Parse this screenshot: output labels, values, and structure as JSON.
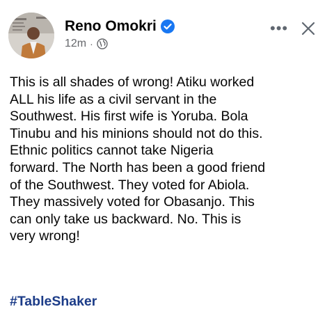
{
  "post": {
    "author": "Reno Omokri",
    "verified_icon": "verified-badge-icon",
    "timestamp": "12m",
    "separator": "·",
    "audience_icon": "globe-icon",
    "more_options": "•••",
    "close_icon": "close-icon",
    "body": "This is all shades of wrong! Atiku worked\nALL his life as a civil servant in the\nSouthwest. His first wife is Yoruba. Bola\nTinubu and his minions should not do this.\nEthnic politics cannot take Nigeria\nforward. The North has been a good friend\nof the Southwest. They voted for Abiola.\nThey massively voted for Obasanjo. This\ncan only take us backward. No. This is\nvery wrong!",
    "hashtag": "#TableShaker"
  },
  "colors": {
    "verified": "#1877f2",
    "meta_text": "#65676b",
    "hashtag": "#1c3c88"
  }
}
